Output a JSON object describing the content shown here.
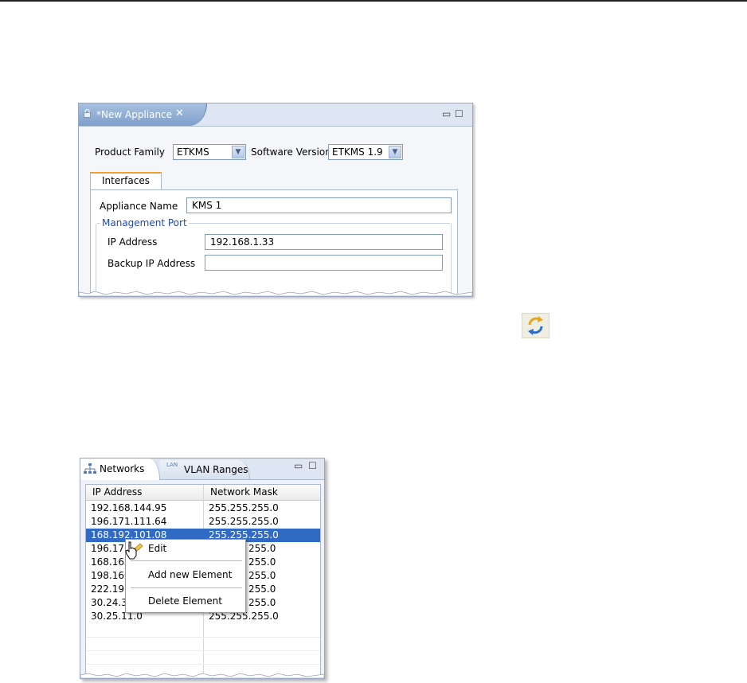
{
  "editor": {
    "tab_title": "*New Appliance",
    "product_family_label": "Product Family",
    "product_family_value": "ETKMS",
    "software_version_label": "Software Version",
    "software_version_value": "ETKMS 1.9",
    "inner_tab": "Interfaces",
    "appliance_name_label": "Appliance Name",
    "appliance_name_value": "KMS 1",
    "group_title": "Management Port",
    "ip_label": "IP Address",
    "ip_value": "192.168.1.33",
    "backup_ip_label": "Backup IP Address",
    "backup_ip_value": ""
  },
  "networks": {
    "tabs": [
      "Networks",
      "VLAN Ranges"
    ],
    "lan_badge": "LAN",
    "columns": [
      "IP Address",
      "Network Mask"
    ],
    "rows": [
      {
        "ip": "192.168.144.95",
        "mask": "255.255.255.0"
      },
      {
        "ip": "196.171.111.64",
        "mask": "255.255.255.0"
      },
      {
        "ip": "168.192.101.08",
        "mask": "255.255.255.0"
      },
      {
        "ip": "196.171",
        "mask": "255.0"
      },
      {
        "ip": "168.162",
        "mask": "255.0"
      },
      {
        "ip": "198.166",
        "mask": "255.0"
      },
      {
        "ip": "222.191",
        "mask": "255.0"
      },
      {
        "ip": "30.24.3",
        "mask": "255.0"
      },
      {
        "ip": "30.25.11.0",
        "mask": "255.255.255.0"
      }
    ],
    "context_menu": {
      "edit": "Edit",
      "add": "Add new Element",
      "delete": "Delete Element"
    }
  },
  "colors": {
    "selection": "#316ac5",
    "group_title": "#1d49c5",
    "tab_gradient_top": "#a8c0e0"
  }
}
